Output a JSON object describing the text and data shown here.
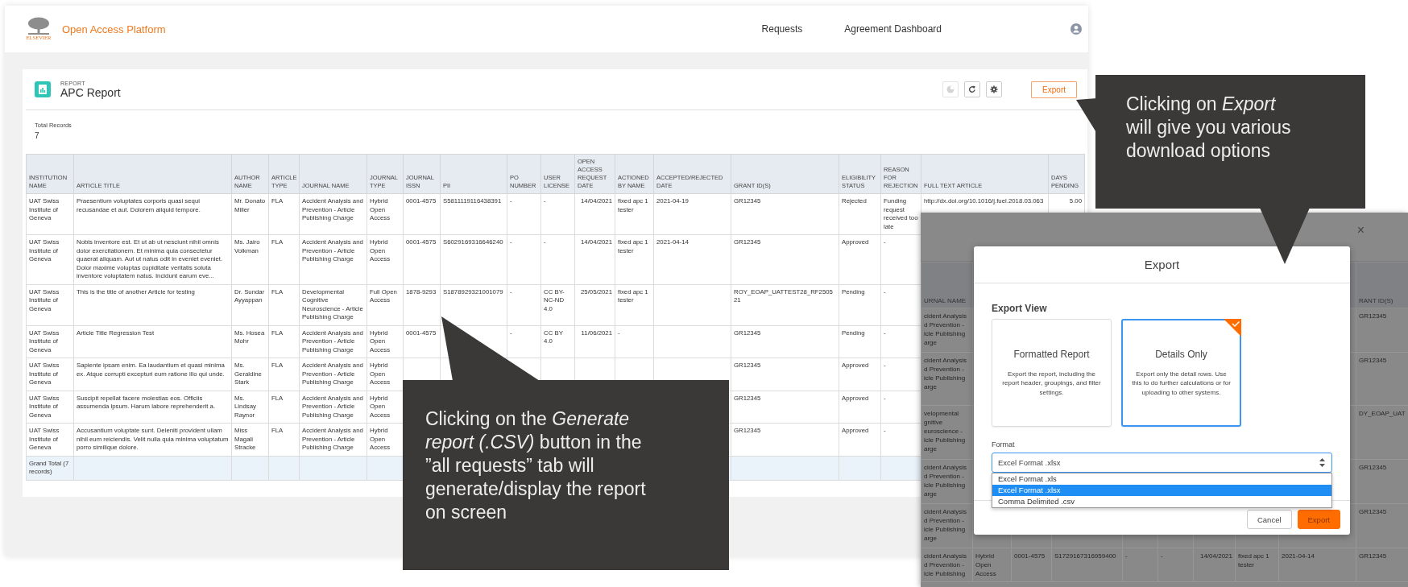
{
  "app": {
    "logo_text": "ELSEVIER",
    "title": "Open Access Platform",
    "nav": [
      {
        "label": "Requests"
      },
      {
        "label": "Agreement Dashboard"
      }
    ]
  },
  "report": {
    "eyebrow": "REPORT",
    "title": "APC Report",
    "toolbar": [
      {
        "kind": "chart",
        "disabled": true
      },
      {
        "kind": "refresh",
        "disabled": false
      },
      {
        "kind": "settings",
        "disabled": false
      }
    ],
    "export_label": "Export",
    "total_label": "Total Records",
    "total_value": "7"
  },
  "table": {
    "columns": [
      "INSTITUTION NAME",
      "ARTICLE TITLE",
      "AUTHOR NAME",
      "ARTICLE TYPE",
      "JOURNAL NAME",
      "JOURNAL TYPE",
      "JOURNAL ISSN",
      "PII",
      "PO NUMBER",
      "USER LICENSE",
      "OPEN ACCESS REQUEST DATE",
      "ACTIONED BY NAME",
      "ACCEPTED/REJECTED DATE",
      "GRANT ID(S)",
      "ELIGIBILITY STATUS",
      "REASON FOR REJECTION",
      "FULL TEXT ARTICLE",
      "DAYS PENDING"
    ],
    "rows": [
      [
        "UAT Swiss Institute of Geneva",
        "Praesentium voluptates corporis quasi sequi recusandae et aut. Dolorem aliquid tempore.",
        "Mr. Donato Miller",
        "FLA",
        "Accident Analysis and Prevention - Article Publishing Charge",
        "Hybrid Open Access",
        "0001-4575",
        "S5811119116438391",
        "-",
        "-",
        "14/04/2021",
        "fixed apc 1 tester",
        "2021-04-19",
        "GR12345",
        "Rejected",
        "Funding request received too late",
        "http://dx.doi.org/10.1016/j.fuel.2018.03.063",
        "5.00"
      ],
      [
        "UAT Swiss Institute of Geneva",
        "Nobis inventore est. Et ut ab ut nesciunt nihil omnis dolor exercitationem. Et minima quia consectetur quaerat aliquam. Aut ut natus odit in eveniet eveniet. Dolor maxime voluptas cupiditate veritatis soluta inventore voluptatem natus. Incidunt earum eve...",
        "Ms. Jairo Volkman",
        "FLA",
        "Accident Analysis and Prevention - Article Publishing Charge",
        "Hybrid Open Access",
        "0001-4575",
        "S6029169316646240",
        "-",
        "-",
        "14/04/2021",
        "fixed apc 1 tester",
        "2021-04-14",
        "GR12345",
        "Approved",
        "-",
        null,
        null
      ],
      [
        "UAT Swiss Institute of Geneva",
        "This is the title of another Article for testing",
        "Dr. Sundar Ayyappan",
        "FLA",
        "Developmental Cognitive Neuroscience - Article Publishing Charge",
        "Full Open Access",
        "1878-9293",
        "S1878929321001079",
        "-",
        "CC BY-NC-ND 4.0",
        "25/05/2021",
        "fixed apc 1 tester",
        null,
        "ROY_EOAP_UATTEST28_RF250521",
        "Pending",
        "-",
        null,
        null
      ],
      [
        "UAT Swiss Institute of Geneva",
        "Article Title Regression Test",
        "Ms. Hosea Mohr",
        "FLA",
        "Accident Analysis and Prevention - Article Publishing Charge",
        "Hybrid Open Access",
        "0001-4575",
        null,
        "-",
        "CC BY 4.0",
        "11/06/2021",
        "-",
        null,
        "GR12345",
        "Pending",
        "-",
        null,
        null
      ],
      [
        "UAT Swiss Institute of Geneva",
        "Sapiente ipsam enim. Ea laudantium et quasi minima ex. Atque corrupti excepturi eum ratione illo qui unde.",
        "Ms. Geraldine Stark",
        "FLA",
        "Accident Analysis and Prevention - Article Publishing Charge",
        "Hybrid Open Access",
        null,
        null,
        null,
        null,
        null,
        null,
        null,
        "GR12345",
        "Approved",
        "-",
        null,
        null
      ],
      [
        "UAT Swiss Institute of Geneva",
        "Suscipit repellat facere molestias eos. Officiis assumenda ipsum. Harum labore reprehenderit a.",
        "Ms. Lindsay Raynor",
        "FLA",
        "Accident Analysis and Prevention - Article Publishing Charge",
        "Hybrid Open Access",
        null,
        null,
        null,
        null,
        null,
        null,
        null,
        "GR12345",
        "Approved",
        "-",
        null,
        null
      ],
      [
        "UAT Swiss Institute of Geneva",
        "Accusantium voluptate sunt. Deleniti provident ullam nihil eum reiciendis. Velit nulla quia minima voluptatum porro similique dolore.",
        "Miss Magali Stracke",
        "FLA",
        "Accident Analysis and Prevention - Article Publishing Charge",
        "Hybrid Open Access",
        null,
        null,
        null,
        null,
        null,
        null,
        null,
        "GR12345",
        "Approved",
        "-",
        null,
        null
      ]
    ],
    "grand_total": "Grand Total (7 records)"
  },
  "export_screenshot": {
    "close": "×",
    "columns": [
      "URNAL NAME",
      null,
      null,
      null,
      null,
      null,
      null,
      null,
      null,
      "RANT ID(S)"
    ],
    "rows": [
      [
        "cident Analysis d Prevention - icle Publishing arge",
        null,
        null,
        null,
        null,
        null,
        null,
        null,
        null,
        "GR12345"
      ],
      [
        "cident Analysis d Prevention - icle Publishing arge",
        null,
        null,
        null,
        null,
        null,
        null,
        null,
        null,
        "GR12345"
      ],
      [
        "velopmental gnitive euroscience - icle Publishing arge",
        null,
        null,
        null,
        null,
        null,
        null,
        null,
        null,
        "DY_EOAP_UAT"
      ],
      [
        "cident Analysis d Prevention - icle Publishing arge",
        null,
        null,
        null,
        null,
        null,
        null,
        null,
        null,
        "GR12345"
      ],
      [
        "cident Analysis d Prevention - icle Publishing arge",
        null,
        null,
        null,
        null,
        null,
        null,
        null,
        null,
        "GR12345"
      ],
      [
        "cident Analysis d Prevention - icle Publishing",
        "Hybrid Open Access",
        "0001-4575",
        "S1729167316959400",
        "-",
        "-",
        "14/04/2021",
        "fixed apc 1 tester",
        "2021-04-14",
        "GR12345"
      ]
    ],
    "dialog": {
      "title": "Export",
      "section_label": "Export View",
      "options": [
        {
          "title": "Formatted Report",
          "description": "Export the report, including the report header, groupings, and filter settings.",
          "selected": false
        },
        {
          "title": "Details Only",
          "description": "Export only the detail rows. Use this to do further calculations or for uploading to other systems.",
          "selected": true
        }
      ],
      "format_label": "Format",
      "format_value": "Excel Format .xlsx",
      "format_options": [
        {
          "label": "Excel Format .xls",
          "selected": false
        },
        {
          "label": "Excel Format .xlsx",
          "selected": true
        },
        {
          "label": "Comma Delimited .csv",
          "selected": false
        }
      ],
      "buttons": [
        {
          "label": "Cancel",
          "kind": "secondary"
        },
        {
          "label": "Export",
          "kind": "primary"
        }
      ]
    }
  },
  "callouts": [
    {
      "kind": "generate",
      "text": "Clicking on the *Generate report (.CSV)* button in the ”all requests” tab will generate/display the report on screen"
    },
    {
      "kind": "export",
      "text": "Clicking on *Export* will give you various download options"
    }
  ]
}
